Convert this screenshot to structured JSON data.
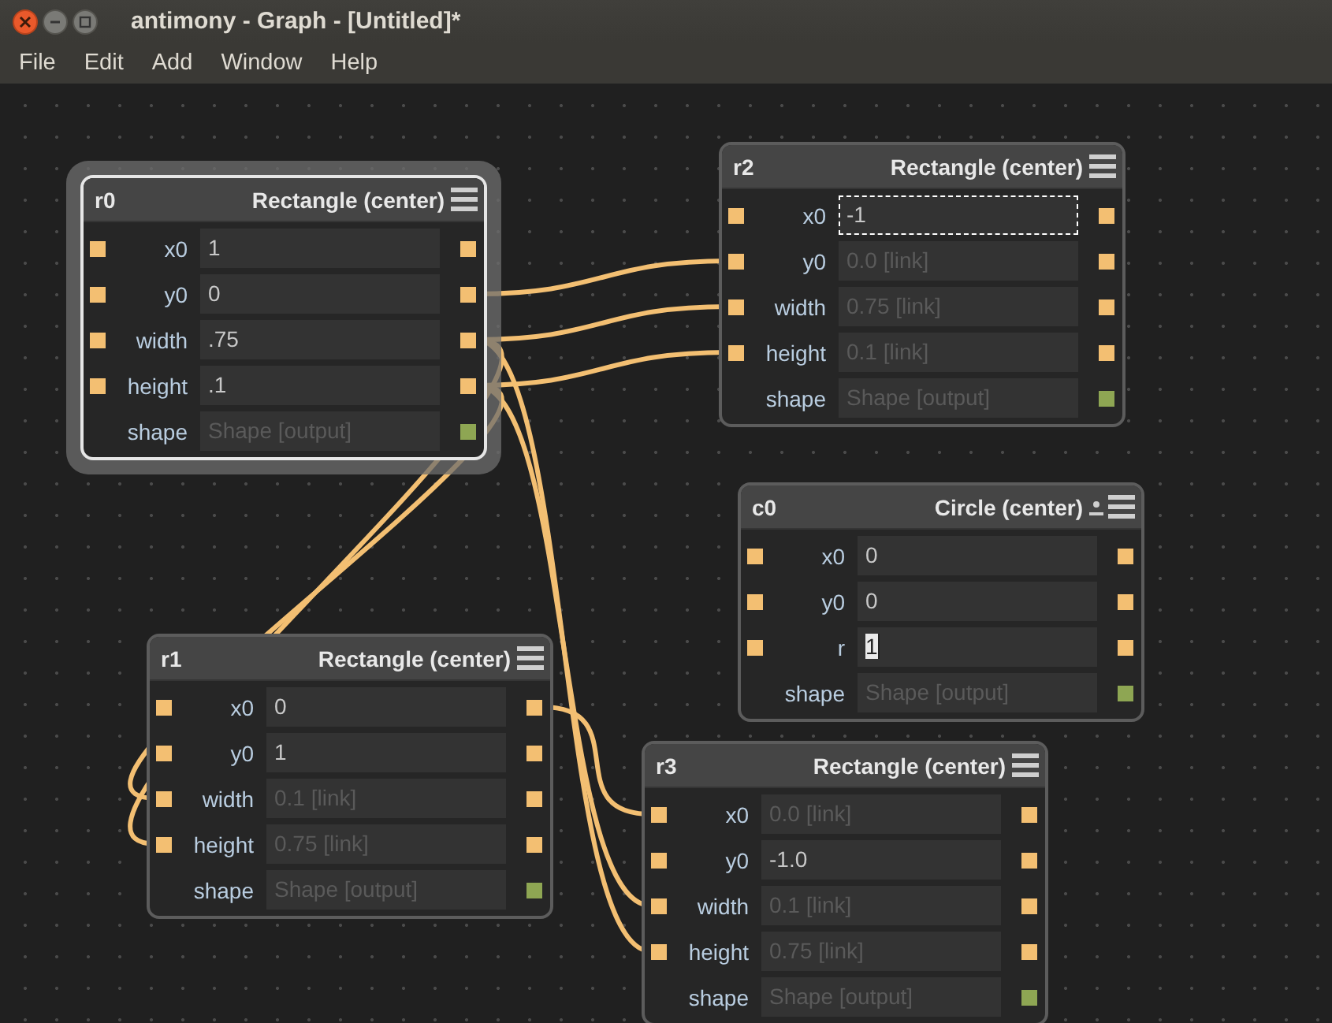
{
  "window": {
    "title": "antimony - Graph - [Untitled]*"
  },
  "menu": [
    "File",
    "Edit",
    "Add",
    "Window",
    "Help"
  ],
  "nodes": [
    {
      "name": "r0",
      "title": "Rectangle (center)",
      "selected": true,
      "indicator": false,
      "rows": [
        {
          "label": "x0",
          "kind": "value",
          "value": "1",
          "focused": false,
          "editing": false
        },
        {
          "label": "y0",
          "kind": "value",
          "value": "0",
          "focused": false,
          "editing": false
        },
        {
          "label": "width",
          "kind": "value",
          "value": ".75",
          "focused": false,
          "editing": false
        },
        {
          "label": "height",
          "kind": "value",
          "value": ".1",
          "focused": false,
          "editing": false
        },
        {
          "label": "shape",
          "kind": "output",
          "placeholder": "Shape [output]",
          "focused": false,
          "editing": false
        }
      ]
    },
    {
      "name": "r2",
      "title": "Rectangle (center)",
      "selected": false,
      "indicator": false,
      "rows": [
        {
          "label": "x0",
          "kind": "value",
          "value": "-1",
          "focused": true,
          "editing": false
        },
        {
          "label": "y0",
          "kind": "link",
          "placeholder": "0.0 [link]",
          "focused": false,
          "editing": false
        },
        {
          "label": "width",
          "kind": "link",
          "placeholder": "0.75 [link]",
          "focused": false,
          "editing": false
        },
        {
          "label": "height",
          "kind": "link",
          "placeholder": "0.1 [link]",
          "focused": false,
          "editing": false
        },
        {
          "label": "shape",
          "kind": "output",
          "placeholder": "Shape [output]",
          "focused": false,
          "editing": false
        }
      ]
    },
    {
      "name": "c0",
      "title": "Circle (center)",
      "selected": false,
      "indicator": true,
      "rows": [
        {
          "label": "x0",
          "kind": "value",
          "value": "0",
          "focused": false,
          "editing": false
        },
        {
          "label": "y0",
          "kind": "value",
          "value": "0",
          "focused": false,
          "editing": false
        },
        {
          "label": "r",
          "kind": "value",
          "value": "1",
          "focused": false,
          "editing": true
        },
        {
          "label": "shape",
          "kind": "output",
          "placeholder": "Shape [output]",
          "focused": false,
          "editing": false
        }
      ]
    },
    {
      "name": "r1",
      "title": "Rectangle (center)",
      "selected": false,
      "indicator": false,
      "rows": [
        {
          "label": "x0",
          "kind": "value",
          "value": "0",
          "focused": false,
          "editing": false
        },
        {
          "label": "y0",
          "kind": "value",
          "value": "1",
          "focused": false,
          "editing": false
        },
        {
          "label": "width",
          "kind": "link",
          "placeholder": "0.1 [link]",
          "focused": false,
          "editing": false
        },
        {
          "label": "height",
          "kind": "link",
          "placeholder": "0.75 [link]",
          "focused": false,
          "editing": false
        },
        {
          "label": "shape",
          "kind": "output",
          "placeholder": "Shape [output]",
          "focused": false,
          "editing": false
        }
      ]
    },
    {
      "name": "r3",
      "title": "Rectangle (center)",
      "selected": false,
      "indicator": false,
      "rows": [
        {
          "label": "x0",
          "kind": "link",
          "placeholder": "0.0 [link]",
          "focused": false,
          "editing": false
        },
        {
          "label": "y0",
          "kind": "value",
          "value": "-1.0",
          "focused": false,
          "editing": false
        },
        {
          "label": "width",
          "kind": "link",
          "placeholder": "0.1 [link]",
          "focused": false,
          "editing": false
        },
        {
          "label": "height",
          "kind": "link",
          "placeholder": "0.75 [link]",
          "focused": false,
          "editing": false
        },
        {
          "label": "shape",
          "kind": "output",
          "placeholder": "Shape [output]",
          "focused": false,
          "editing": false
        }
      ]
    }
  ]
}
